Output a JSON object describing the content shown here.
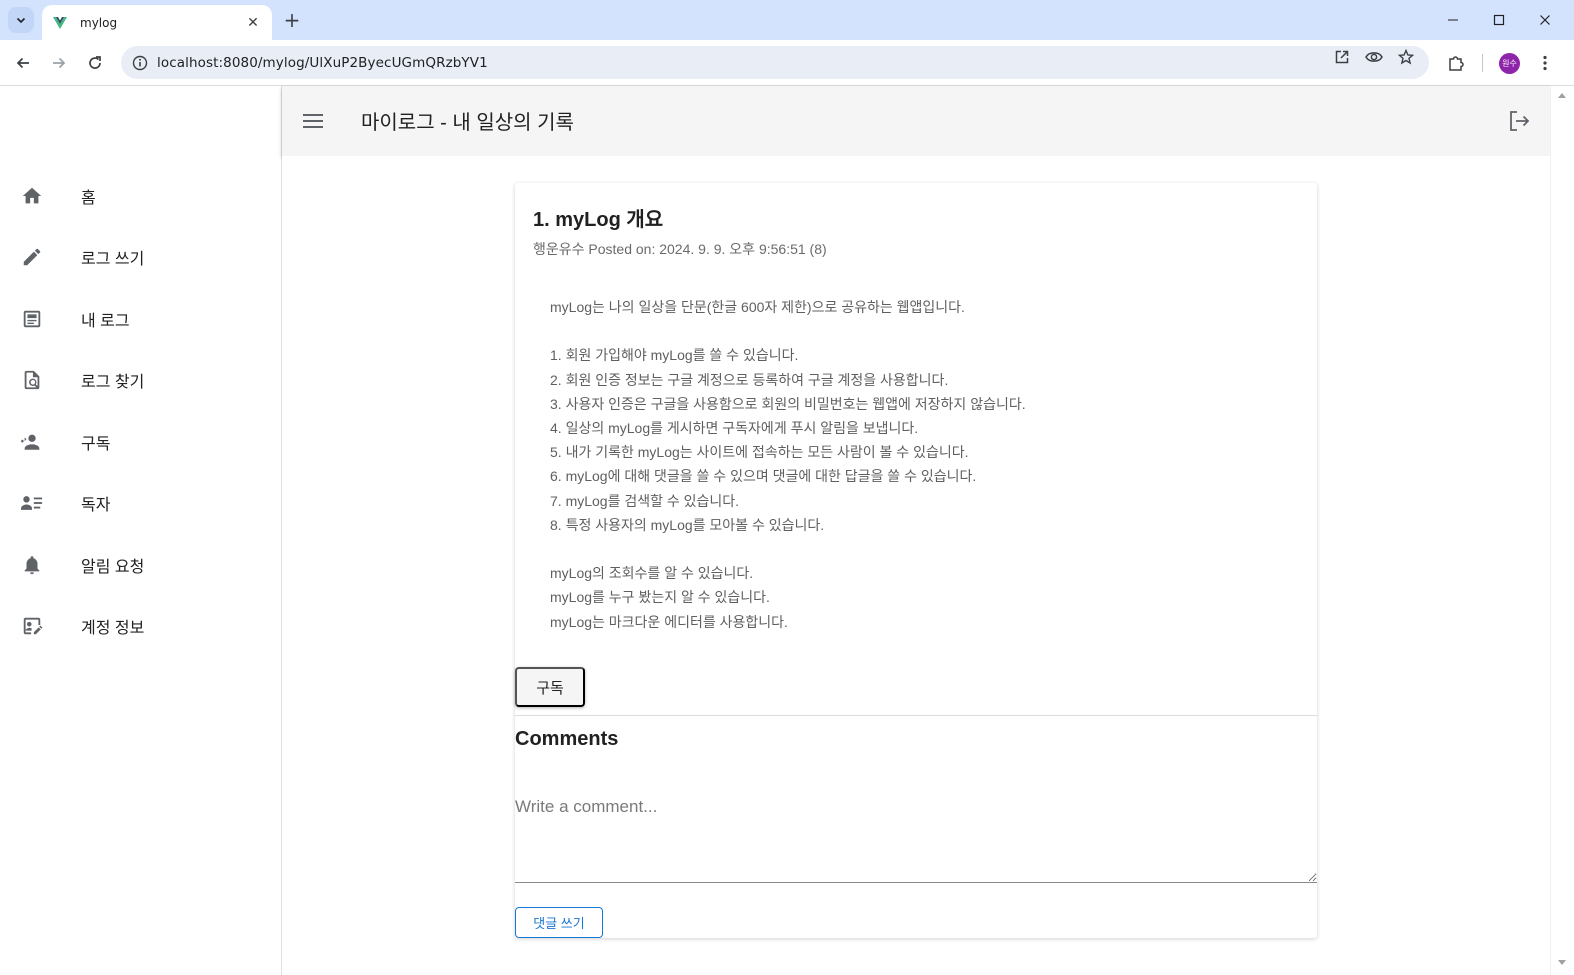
{
  "browser": {
    "tab_title": "mylog",
    "url": "localhost:8080/mylog/UlXuP2ByecUGmQRzbYV1",
    "profile_initials": "원수"
  },
  "app": {
    "title": "마이로그 - 내 일상의 기록"
  },
  "sidebar": {
    "items": [
      {
        "label": "홈",
        "icon": "home-icon"
      },
      {
        "label": "로그 쓰기",
        "icon": "pencil-icon"
      },
      {
        "label": "내 로그",
        "icon": "article-icon"
      },
      {
        "label": "로그 찾기",
        "icon": "find-in-page-icon"
      },
      {
        "label": "구독",
        "icon": "subscribers-icon"
      },
      {
        "label": "독자",
        "icon": "reader-list-icon"
      },
      {
        "label": "알림 요청",
        "icon": "bell-icon"
      },
      {
        "label": "계정 정보",
        "icon": "edit-account-icon"
      }
    ]
  },
  "post": {
    "title": "1. myLog 개요",
    "meta": "행운유수 Posted on: 2024. 9. 9. 오후 9:56:51 (8)",
    "lines": [
      "myLog는 나의 일상을 단문(한글 600자 제한)으로 공유하는 웹앱입니다.",
      "",
      "1. 회원 가입해야 myLog를 쓸 수 있습니다.",
      "2. 회원 인증 정보는 구글 계정으로 등록하여 구글 계정을 사용합니다.",
      "3. 사용자 인증은 구글을 사용함으로 회원의 비밀번호는 웹앱에 저장하지 않습니다.",
      "4. 일상의 myLog를 게시하면 구독자에게 푸시 알림을 보냅니다.",
      "5. 내가 기록한 myLog는 사이트에 접속하는 모든 사람이 볼 수 있습니다.",
      "6. myLog에 대해 댓글을 쓸 수 있으며 댓글에 대한 답글을 쓸 수 있습니다.",
      "7. myLog를 검색할 수 있습니다.",
      "8. 특정 사용자의 myLog를 모아볼 수 있습니다.",
      "",
      "myLog의 조회수를 알 수 있습니다.",
      "myLog를 누구 봤는지 알 수 있습니다.",
      "myLog는 마크다운 에디터를 사용합니다."
    ],
    "subscribe_label": "구독"
  },
  "comments": {
    "title": "Comments",
    "placeholder": "Write a comment...",
    "value": "",
    "submit_label": "댓글 쓰기"
  }
}
